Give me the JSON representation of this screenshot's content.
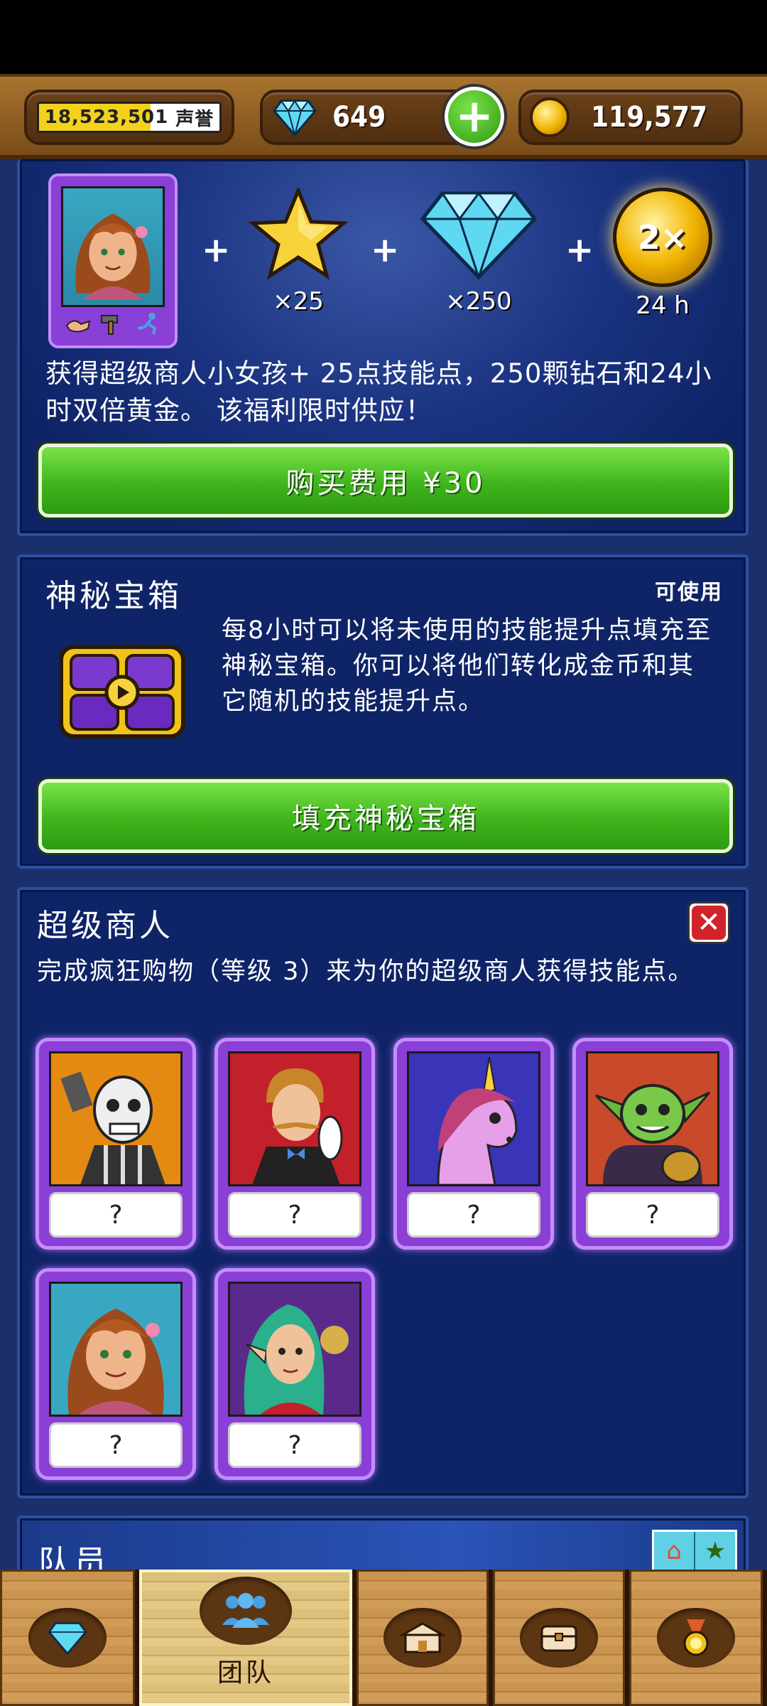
{
  "status_bar": {
    "reputation_value": "18,523,501",
    "reputation_label": "声誉",
    "gems": "649",
    "gold": "119,577"
  },
  "offer": {
    "skill_points": "×25",
    "diamonds": "×250",
    "multiplier_badge": "2×",
    "multiplier_duration": "24 h",
    "description": "获得超级商人小女孩+ 25点技能点，250颗钻石和24小时双倍黄金。 该福利限时供应！",
    "buy_button": "购买费用 ¥30"
  },
  "mystery_chest": {
    "title": "神秘宝箱",
    "status": "可使用",
    "description": "每8小时可以将未使用的技能提升点填充至神秘宝箱。你可以将他们转化成金币和其它随机的技能提升点。",
    "button": "填充神秘宝箱"
  },
  "super_merchant": {
    "title": "超级商人",
    "description": "完成疯狂购物（等级 3）来为你的超级商人获得技能点。",
    "cards": [
      {
        "character": "skeleton-blacksmith",
        "label": "?",
        "bg": "#e48a12"
      },
      {
        "character": "gentleman",
        "label": "?",
        "bg": "#c2202a"
      },
      {
        "character": "unicorn",
        "label": "?",
        "bg": "#3a34b8"
      },
      {
        "character": "goblin",
        "label": "?",
        "bg": "#c84a2a"
      },
      {
        "character": "merchant-girl",
        "label": "?",
        "bg": "#3aa7c2"
      },
      {
        "character": "elf",
        "label": "?",
        "bg": "#5a2a8a"
      }
    ]
  },
  "team": {
    "title": "队员"
  },
  "bottom_nav": [
    {
      "icon": "gem-icon",
      "label": ""
    },
    {
      "icon": "team-icon",
      "label": "团队"
    },
    {
      "icon": "shop-icon",
      "label": ""
    },
    {
      "icon": "chest-icon",
      "label": ""
    },
    {
      "icon": "medal-icon",
      "label": ""
    }
  ],
  "colors": {
    "panel": "#0f2466",
    "button_green": "#3fb51c",
    "card_purple": "#8a3fd6",
    "wood": "#a8742f"
  }
}
